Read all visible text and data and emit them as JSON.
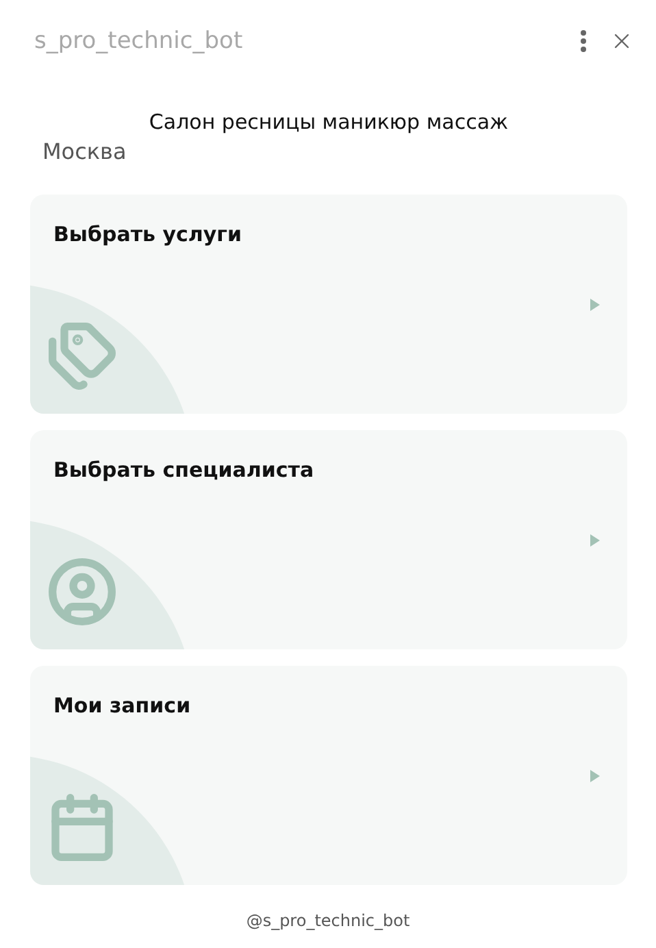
{
  "window": {
    "title": "s_pro_technic_bot"
  },
  "header": {
    "title": "Салон ресницы маникюр массаж",
    "city": "Москва"
  },
  "cards": [
    {
      "label": "Выбрать услуги",
      "kind": "services"
    },
    {
      "label": "Выбрать специалиста",
      "kind": "specialist"
    },
    {
      "label": "Мои записи",
      "kind": "bookings"
    }
  ],
  "footer": "@s_pro_technic_bot"
}
